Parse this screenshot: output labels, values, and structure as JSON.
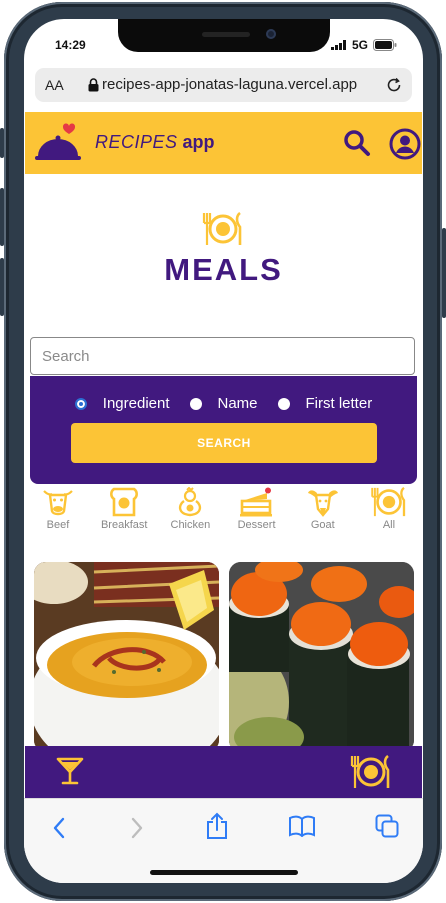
{
  "status_bar": {
    "time": "14:29",
    "network": "5G"
  },
  "browser": {
    "text_size": "AA",
    "url": "recipes-app-jonatas-laguna.vercel.app"
  },
  "header": {
    "logo_text": "RECIPES",
    "logo_suffix": "app"
  },
  "page": {
    "title": "MEALS"
  },
  "search": {
    "placeholder": "Search",
    "value": ""
  },
  "filters": {
    "options": [
      "Ingredient",
      "Name",
      "First letter"
    ],
    "selected": "Ingredient",
    "button_label": "SEARCH"
  },
  "categories": [
    {
      "label": "Beef",
      "icon": "beef-icon"
    },
    {
      "label": "Breakfast",
      "icon": "breakfast-icon"
    },
    {
      "label": "Chicken",
      "icon": "chicken-icon"
    },
    {
      "label": "Dessert",
      "icon": "dessert-icon"
    },
    {
      "label": "Goat",
      "icon": "goat-icon"
    },
    {
      "label": "All",
      "icon": "all-meals-icon"
    }
  ],
  "colors": {
    "brand_yellow": "#fcc436",
    "brand_purple": "#41197f"
  }
}
